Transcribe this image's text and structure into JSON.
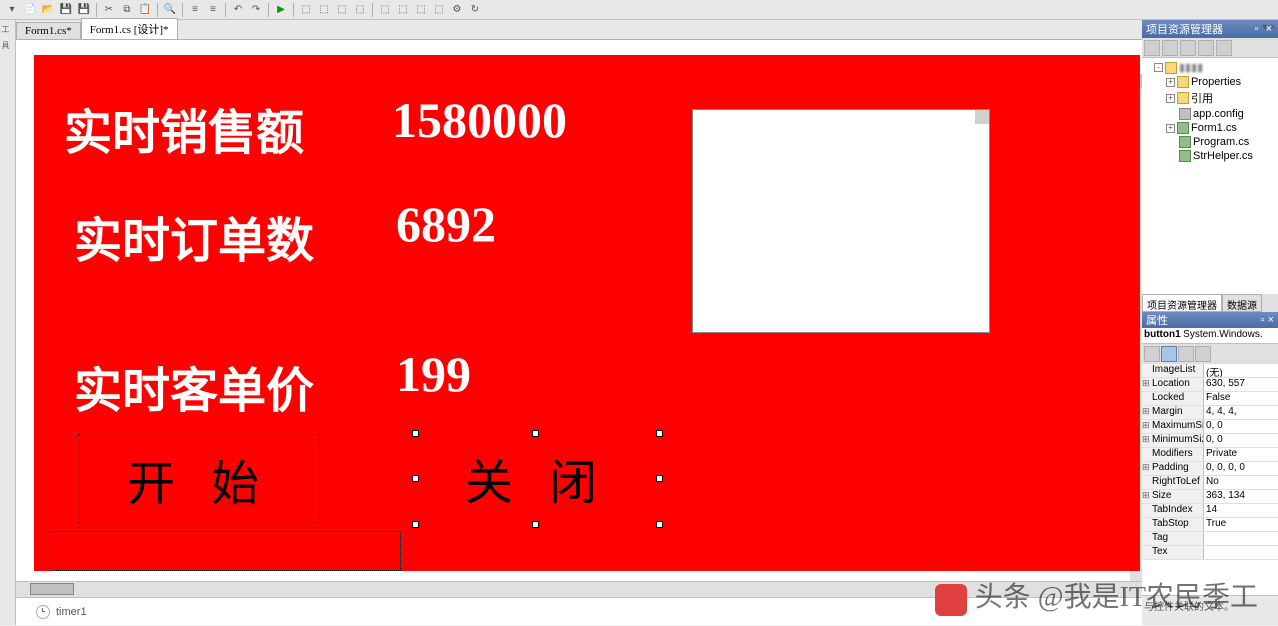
{
  "toolbar_icons": [
    "new",
    "add",
    "open",
    "save",
    "saveall",
    "",
    "cut",
    "copy",
    "paste",
    "",
    "find",
    "",
    "indent",
    "outdent",
    "",
    "undo",
    "redo",
    "",
    "run",
    "stop",
    "",
    "step-over",
    "step-into",
    "step-out",
    "",
    "window",
    "tools",
    "ext",
    "",
    "settings",
    "refresh"
  ],
  "tabs": [
    {
      "label": "Form1.cs*",
      "active": false
    },
    {
      "label": "Form1.cs [设计]*",
      "active": true
    }
  ],
  "form": {
    "label_sales": "实时销售额",
    "value_sales": "1580000",
    "label_orders": "实时订单数",
    "value_orders": "6892",
    "label_avg": "实时客单价",
    "value_avg": "199",
    "btn_start": "开 始",
    "btn_close": "关 闭"
  },
  "tray": {
    "timer": "timer1"
  },
  "solution_explorer": {
    "title": "项目资源管理器",
    "nodes": [
      {
        "label": "Properties",
        "icon": "folder",
        "indent": 2,
        "exp": "+"
      },
      {
        "label": "引用",
        "icon": "folder",
        "indent": 2,
        "exp": "+"
      },
      {
        "label": "app.config",
        "icon": "cfg",
        "indent": 2
      },
      {
        "label": "Form1.cs",
        "icon": "cs",
        "indent": 2,
        "exp": "+"
      },
      {
        "label": "Program.cs",
        "icon": "cs",
        "indent": 2
      },
      {
        "label": "StrHelper.cs",
        "icon": "cs",
        "indent": 2
      }
    ],
    "bottom_tabs": [
      {
        "label": "项目资源管理器",
        "on": true
      },
      {
        "label": "数据源",
        "on": false
      }
    ]
  },
  "properties": {
    "title": "属性",
    "object": "button1",
    "object_type": "System.Windows.",
    "rows": [
      {
        "k": "ImageList",
        "v": "(无)",
        "exp": false
      },
      {
        "k": "Location",
        "v": "630, 557",
        "exp": true
      },
      {
        "k": "Locked",
        "v": "False",
        "exp": false
      },
      {
        "k": "Margin",
        "v": "4, 4, 4,",
        "exp": true
      },
      {
        "k": "MaximumSiz",
        "v": "0, 0",
        "exp": true
      },
      {
        "k": "MinimumSiz",
        "v": "0, 0",
        "exp": true
      },
      {
        "k": "Modifiers",
        "v": "Private",
        "exp": false
      },
      {
        "k": "Padding",
        "v": "0, 0, 0, 0",
        "exp": true
      },
      {
        "k": "RightToLef",
        "v": "No",
        "exp": false
      },
      {
        "k": "Size",
        "v": "363, 134",
        "exp": true
      },
      {
        "k": "TabIndex",
        "v": "14",
        "exp": false
      },
      {
        "k": "TabStop",
        "v": "True",
        "exp": false
      },
      {
        "k": "Tag",
        "v": "",
        "exp": false
      },
      {
        "k": "Tex",
        "v": "",
        "exp": false
      }
    ],
    "desc": "与控件关联的文本。"
  },
  "watermark": "头条 @我是IT农民季工"
}
